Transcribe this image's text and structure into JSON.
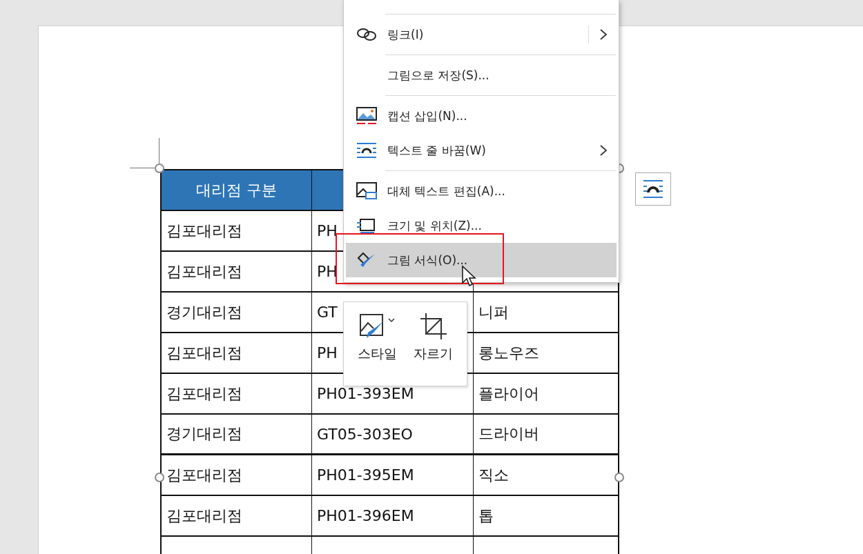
{
  "document": {
    "table": {
      "header": {
        "column_1": "대리점 구분"
      },
      "rows": [
        {
          "column_1": "김포대리점",
          "column_2": "PH"
        },
        {
          "column_1": "김포대리점",
          "column_2": "PH"
        },
        {
          "column_1": "경기대리점",
          "column_2": "GT",
          "column_3": "니퍼"
        },
        {
          "column_1": "김포대리점",
          "column_2": "PH",
          "column_3": "롱노우즈"
        },
        {
          "column_1": "김포대리점",
          "column_2": "PH01-393EM",
          "column_3": "플라이어"
        },
        {
          "column_1": "경기대리점",
          "column_2": "GT05-303EO",
          "column_3": "드라이버"
        },
        {
          "column_1": "김포대리점",
          "column_2": "PH01-395EM",
          "column_3": "직소"
        },
        {
          "column_1": "김포대리점",
          "column_2": "PH01-396EM",
          "column_3": "톱"
        }
      ]
    }
  },
  "context_menu": {
    "groups": [
      [
        {
          "label": "링크(I)",
          "submenu": true,
          "selected": false
        }
      ],
      [
        {
          "label": "그림으로 저장(S)...",
          "submenu": false,
          "selected": false
        }
      ],
      [
        {
          "label": "캡션 삽입(N)...",
          "submenu": false,
          "selected": false
        },
        {
          "label": "텍스트 줄 바꿈(W)",
          "submenu": true,
          "selected": false
        }
      ],
      [
        {
          "label": "대체 텍스트 편집(A)...",
          "submenu": false,
          "selected": false
        },
        {
          "label": "크기 및 위치(Z)...",
          "submenu": false,
          "selected": false
        },
        {
          "label": "그림 서식(O)...",
          "submenu": false,
          "selected": true
        }
      ]
    ]
  },
  "mini_toolbar": {
    "buttons": [
      {
        "label": "스타일"
      },
      {
        "label": "자르기"
      }
    ]
  }
}
